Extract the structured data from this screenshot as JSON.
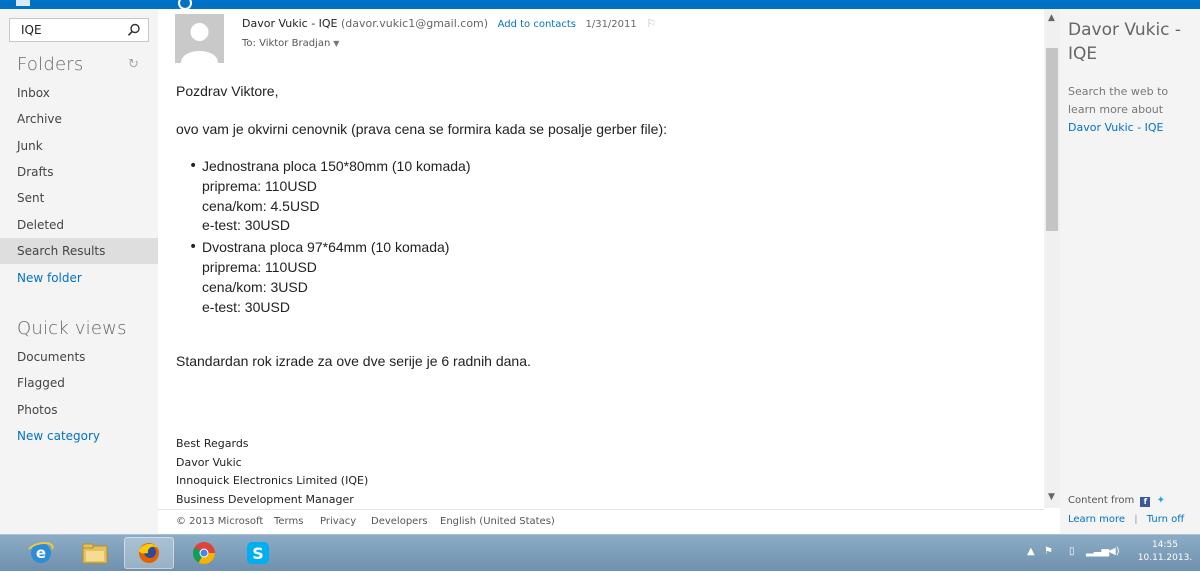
{
  "search": {
    "value": "IQE",
    "placeholder": ""
  },
  "folders": {
    "title": "Folders",
    "items": [
      {
        "label": "Inbox"
      },
      {
        "label": "Archive"
      },
      {
        "label": "Junk"
      },
      {
        "label": "Drafts"
      },
      {
        "label": "Sent"
      },
      {
        "label": "Deleted"
      },
      {
        "label": "Search Results",
        "selected": true
      }
    ],
    "new_folder": "New folder"
  },
  "quick_views": {
    "title": "Quick views",
    "items": [
      {
        "label": "Documents"
      },
      {
        "label": "Flagged"
      },
      {
        "label": "Photos"
      }
    ],
    "new_category": "New category"
  },
  "message": {
    "sender_name": "Davor Vukic - IQE",
    "sender_email": "(davor.vukic1@gmail.com)",
    "add_to_contacts": "Add to contacts",
    "date": "1/31/2011",
    "to": "To: Viktor Bradjan",
    "greeting": "Pozdrav Viktore,",
    "intro": "ovo vam je okvirni cenovnik (prava cena se formira kada se posalje gerber file):",
    "items": [
      {
        "title": "Jednostrana ploca 150*80mm (10 komada)",
        "lines": [
          "priprema: 110USD",
          "cena/kom: 4.5USD",
          "e-test: 30USD"
        ]
      },
      {
        "title": "Dvostrana ploca 97*64mm (10 komada)",
        "lines": [
          "priprema: 110USD",
          "cena/kom: 3USD",
          "e-test: 30USD"
        ]
      }
    ],
    "closing": "Standardan rok izrade za ove dve serije je 6 radnih dana.",
    "signature": [
      "Best Regards",
      "Davor Vukic",
      "Innoquick Electronics Limited (IQE)",
      "Business Development Manager"
    ]
  },
  "footer": {
    "copyright": "© 2013 Microsoft",
    "terms": "Terms",
    "privacy": "Privacy",
    "developers": "Developers",
    "language": "English (United States)"
  },
  "right_pane": {
    "title": "Davor Vukic - IQE",
    "search_text": "Search the web to learn more about",
    "search_link": "Davor Vukic - IQE",
    "content_from": "Content from",
    "learn_more": "Learn more",
    "separator": "|",
    "turn_off": "Turn off"
  },
  "taskbar": {
    "apps": [
      "ie-icon",
      "file-explorer-icon",
      "firefox-icon",
      "chrome-icon",
      "skype-icon"
    ],
    "clock_time": "14:55",
    "clock_date": "10.11.2013."
  }
}
